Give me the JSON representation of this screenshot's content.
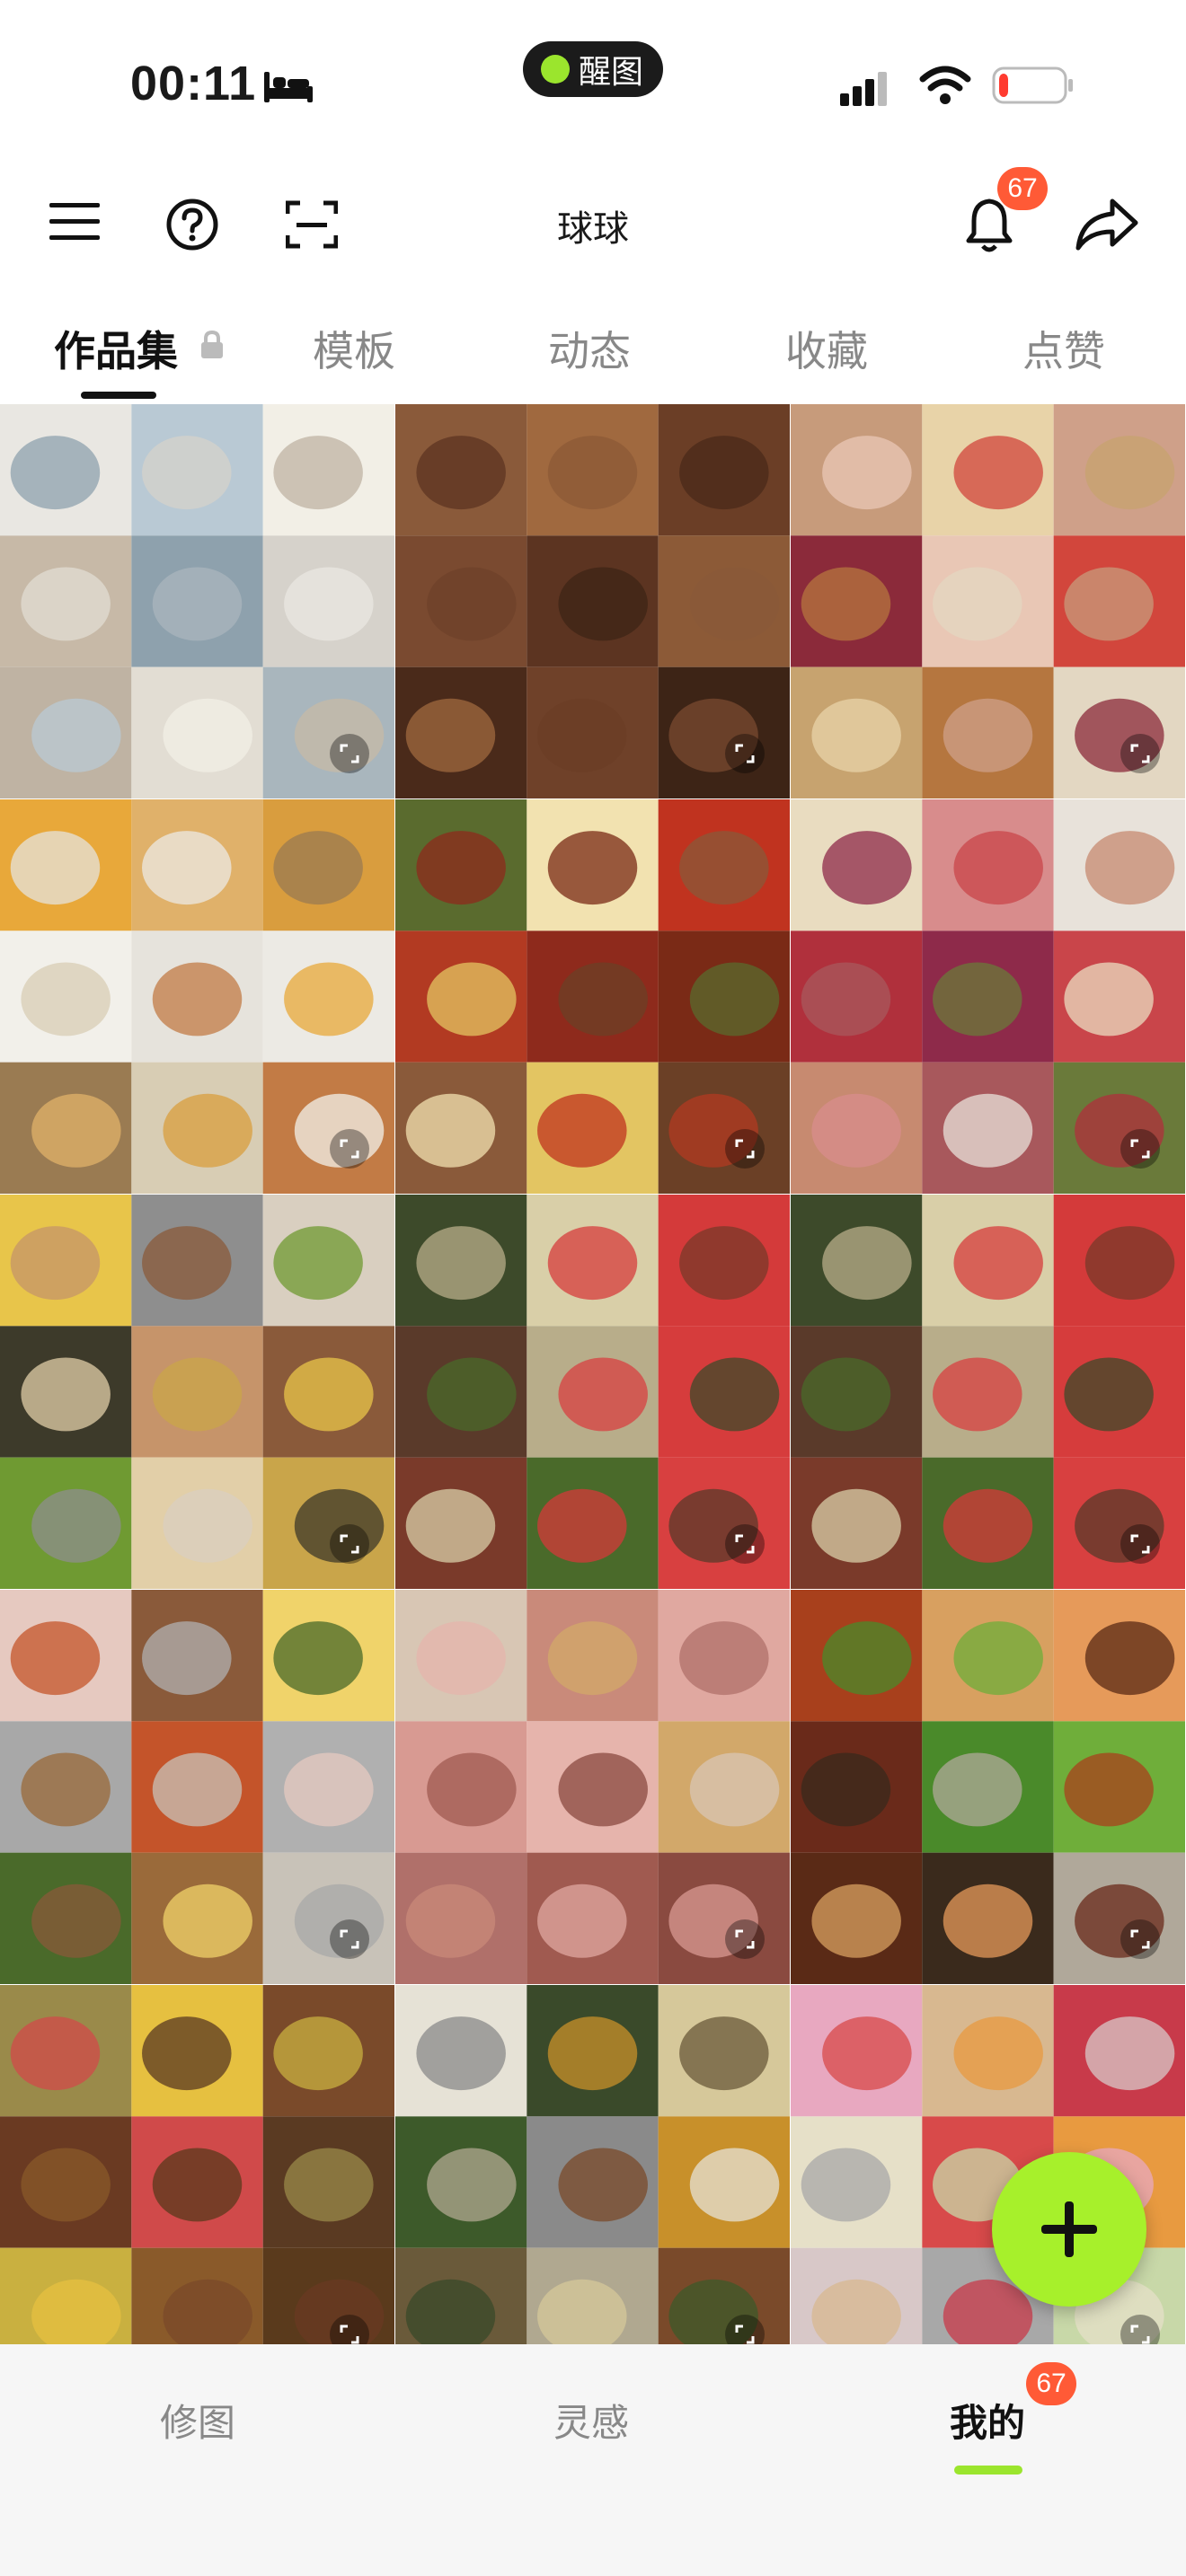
{
  "status_bar": {
    "time": "00:11",
    "pill_label": "醒图",
    "battery_level": 0.15,
    "battery_color": "#ff3b30"
  },
  "header": {
    "title": "球球",
    "notification_count": "67"
  },
  "tabs": [
    {
      "label": "作品集",
      "active": true,
      "locked": true
    },
    {
      "label": "模板",
      "active": false
    },
    {
      "label": "动态",
      "active": false
    },
    {
      "label": "收藏",
      "active": false
    },
    {
      "label": "点赞",
      "active": false
    }
  ],
  "grid": {
    "items": [
      {
        "name": "milk tea cups collage",
        "palette": [
          "#e9e7e2",
          "#b9c9d4",
          "#f2efe6",
          "#c7b9a7",
          "#8ea1ad",
          "#d6d2cb",
          "#bfb3a3",
          "#e2ddd3",
          "#a9b6bd"
        ]
      },
      {
        "name": "grilled skewers",
        "palette": [
          "#8a5a3a",
          "#a0693f",
          "#6b3e26",
          "#7a4a30",
          "#5c3421",
          "#8c5a37",
          "#4a2a1a",
          "#6f4129",
          "#3d2416"
        ]
      },
      {
        "name": "desserts collage",
        "palette": [
          "#c79b7b",
          "#e8d3a8",
          "#cfa089",
          "#8b2a3a",
          "#e9c7b5",
          "#d2463c",
          "#c7a36f",
          "#b5763f",
          "#e3d7c2"
        ]
      },
      {
        "name": "snacks and drinks collage",
        "palette": [
          "#e8a83a",
          "#e0b16a",
          "#d99d3e",
          "#f2f0ea",
          "#e6e3dc",
          "#eceae4",
          "#9a7b52",
          "#d8cdb4",
          "#c27b45"
        ]
      },
      {
        "name": "spicy dishes collage",
        "palette": [
          "#5a6b2e",
          "#f2e2b0",
          "#c0331f",
          "#b23a22",
          "#8e2a1c",
          "#7a2a16",
          "#8a5a3a",
          "#e3c562",
          "#6b4026"
        ]
      },
      {
        "name": "hotpot meats collage",
        "palette": [
          "#e9dcc0",
          "#d88c8c",
          "#e8e2da",
          "#b0303c",
          "#8e2a4a",
          "#c9454a",
          "#c78a70",
          "#a8585c",
          "#6a7a3a"
        ]
      },
      {
        "name": "home dishes collage",
        "palette": [
          "#e8c54a",
          "#8e8e8e",
          "#d9cfc0",
          "#3d3a2a",
          "#c6946a",
          "#8a5a3a",
          "#6f9a32",
          "#e2cfa8",
          "#c9a54a"
        ]
      },
      {
        "name": "stir fried dishes collage A",
        "palette": [
          "#3d4a2a",
          "#d9cfa8",
          "#d43a3a",
          "#5a3a2a",
          "#b8ad8a",
          "#d63c3c",
          "#7a3a2a",
          "#4a6a2a",
          "#d84040"
        ]
      },
      {
        "name": "stir fried dishes collage B",
        "palette": [
          "#3d4a2a",
          "#d9cfa8",
          "#d43a3a",
          "#5a3a2a",
          "#b8ad8a",
          "#d63c3c",
          "#7a3a2a",
          "#4a6a2a",
          "#d84040"
        ]
      },
      {
        "name": "bbq and seafood collage",
        "palette": [
          "#e6c9c0",
          "#8a5a3a",
          "#f0d36a",
          "#a8a8a8",
          "#c4542a",
          "#b0b0b0",
          "#4a6a2a",
          "#9a6a3a",
          "#c8c2b8"
        ]
      },
      {
        "name": "pork belly platter collage",
        "palette": [
          "#d8c6b4",
          "#c98a7a",
          "#e0a8a0",
          "#d89a92",
          "#e6b4ac",
          "#d2a86a",
          "#b0706a",
          "#a05a50",
          "#8a4a40"
        ]
      },
      {
        "name": "beef and greens collage",
        "palette": [
          "#a8401c",
          "#d8a060",
          "#e69a5a",
          "#6a2a1a",
          "#4a8a2a",
          "#6fae3a",
          "#5a2a16",
          "#3a2a1c",
          "#b0a89a"
        ]
      },
      {
        "name": "fried noodles and skewers collage",
        "palette": [
          "#9a8a4a",
          "#e6c040",
          "#7a4a2a",
          "#6a3a22",
          "#d04a4a",
          "#5a3a22",
          "#c9b040",
          "#8a5a2a",
          "#5a3a1c"
        ]
      },
      {
        "name": "green beans and chicken collage",
        "palette": [
          "#e6e2d6",
          "#3a4a2a",
          "#d6c89a",
          "#3d5a2a",
          "#8a8a8a",
          "#c8902a",
          "#6a5a3a",
          "#b0a890",
          "#7a4a2a"
        ]
      },
      {
        "name": "drinks collage",
        "palette": [
          "#e8a8c0",
          "#d8b890",
          "#c83a4a",
          "#e6e0c8",
          "#d84a4a",
          "#e89a40",
          "#d8c8c8",
          "#a8a8a8",
          "#c8d8a8"
        ]
      }
    ]
  },
  "fab": {
    "label": "+",
    "color": "#a7f02b"
  },
  "bottom_nav": [
    {
      "label": "修图",
      "active": false
    },
    {
      "label": "灵感",
      "active": false
    },
    {
      "label": "我的",
      "active": true,
      "badge": "67"
    }
  ]
}
